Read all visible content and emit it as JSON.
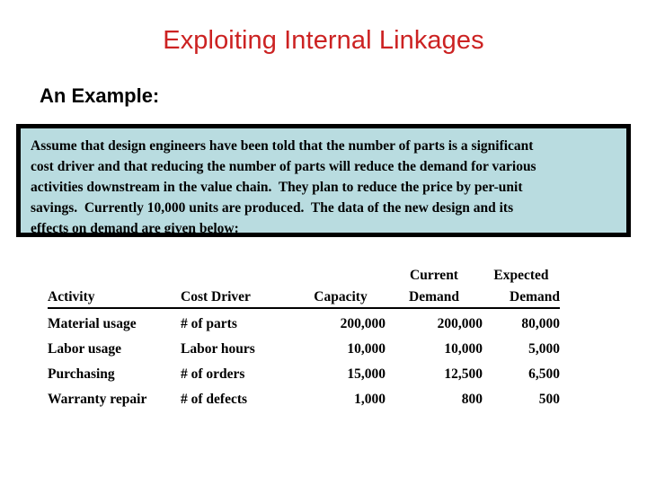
{
  "slide": {
    "title": "Exploiting Internal Linkages",
    "subtitle": "An Example:",
    "title_color": "#cc2222",
    "callout_fill": "#b9dce0",
    "callout_border": "#000000"
  },
  "callout": {
    "lines": [
      "Assume that design engineers have been told that the number of parts is a significant",
      "cost driver and that reducing the number of parts will reduce the demand for various",
      "activities downstream in the value chain.  They plan to reduce the price by per-unit",
      "savings.  Currently 10,000 units are produced.  The data of the new design and its",
      "effects on demand are given below:"
    ]
  },
  "table": {
    "headers_top": [
      "",
      "",
      "",
      "Current",
      "Expected"
    ],
    "headers": [
      "Activity",
      "Cost Driver",
      "Capacity",
      "Demand",
      "Demand"
    ],
    "rows": [
      {
        "activity": "Material usage",
        "cost_driver": "# of parts",
        "capacity": "200,000",
        "current_demand": "200,000",
        "expected_demand": "80,000"
      },
      {
        "activity": "Labor usage",
        "cost_driver": "Labor hours",
        "capacity": "10,000",
        "current_demand": "10,000",
        "expected_demand": "5,000"
      },
      {
        "activity": "Purchasing",
        "cost_driver": "# of orders",
        "capacity": "15,000",
        "current_demand": "12,500",
        "expected_demand": "6,500"
      },
      {
        "activity": "Warranty repair",
        "cost_driver": "# of defects",
        "capacity": "1,000",
        "current_demand": "800",
        "expected_demand": "500"
      }
    ]
  }
}
